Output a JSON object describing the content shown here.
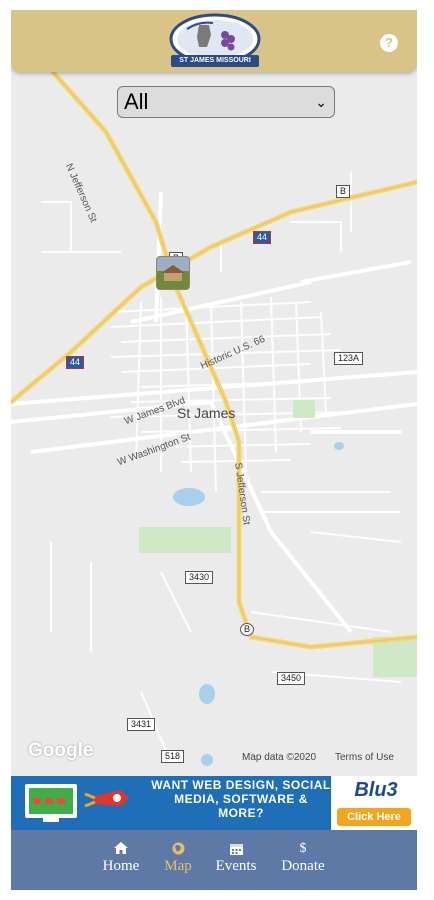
{
  "header": {
    "logo_text": "ST JAMES MISSOURI",
    "help_label": "?"
  },
  "filter": {
    "selected": "All"
  },
  "map": {
    "labels": {
      "n_jefferson": "N Jefferson St",
      "s_jefferson": "S Jefferson St",
      "historic_66": "Historic U.S. 66",
      "w_james": "W James Blvd",
      "w_washington": "W Washington St",
      "city": "St James"
    },
    "shields": {
      "b_top": "B",
      "b_mid": "B",
      "i44_east": "44",
      "i44_west": "44",
      "r123a": "123A",
      "r3430": "3430",
      "r3450": "3450",
      "r3431": "3431",
      "r518": "518",
      "b_south": "B"
    },
    "google": "Google",
    "map_data": "Map data ©2020",
    "terms": "Terms of Use"
  },
  "ad": {
    "headline": "WANT WEB DESIGN, SOCIAL MEDIA, SOFTWARE & MORE?",
    "brand": "Blu3",
    "cta": "Click Here"
  },
  "nav": {
    "home": "Home",
    "map": "Map",
    "events": "Events",
    "donate": "Donate",
    "donate_symbol": "$"
  }
}
